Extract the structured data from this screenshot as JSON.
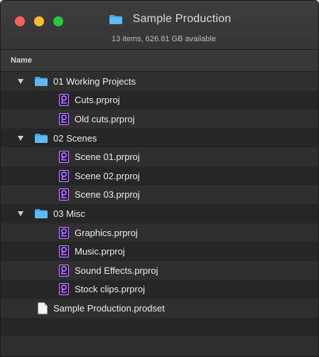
{
  "window": {
    "title": "Sample Production",
    "subtitle": "13 items, 626.81 GB available"
  },
  "colors": {
    "folder": "#40a8e6",
    "premiere_purple": "#2e0f52",
    "premiere_accent": "#c58cff"
  },
  "columns": {
    "name": "Name"
  },
  "rows": [
    {
      "kind": "folder",
      "label": "01 Working Projects",
      "icon": "folder-icon"
    },
    {
      "kind": "child",
      "label": "Cuts.prproj",
      "icon": "premiere-file-icon"
    },
    {
      "kind": "child",
      "label": "Old cuts.prproj",
      "icon": "premiere-file-icon"
    },
    {
      "kind": "folder",
      "label": "02 Scenes",
      "icon": "folder-icon"
    },
    {
      "kind": "child",
      "label": "Scene 01.prproj",
      "icon": "premiere-file-icon"
    },
    {
      "kind": "child",
      "label": "Scene 02.prproj",
      "icon": "premiere-file-icon"
    },
    {
      "kind": "child",
      "label": "Scene 03.prproj",
      "icon": "premiere-file-icon"
    },
    {
      "kind": "folder",
      "label": "03 Misc",
      "icon": "folder-icon"
    },
    {
      "kind": "child",
      "label": "Graphics.prproj",
      "icon": "premiere-file-icon"
    },
    {
      "kind": "child",
      "label": "Music.prproj",
      "icon": "premiere-file-icon"
    },
    {
      "kind": "child",
      "label": "Sound Effects.prproj",
      "icon": "premiere-file-icon"
    },
    {
      "kind": "child",
      "label": "Stock clips.prproj",
      "icon": "premiere-file-icon"
    },
    {
      "kind": "root-file",
      "label": "Sample Production.prodset",
      "icon": "document-icon"
    }
  ]
}
